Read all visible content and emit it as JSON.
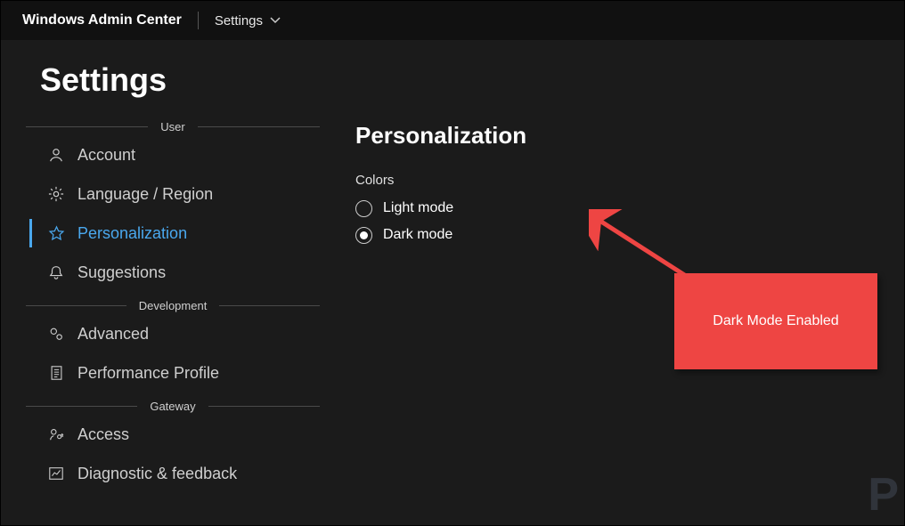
{
  "topbar": {
    "appTitle": "Windows Admin Center",
    "breadcrumb": "Settings"
  },
  "pageTitle": "Settings",
  "sidebar": {
    "sections": [
      {
        "label": "User",
        "items": [
          {
            "label": "Account"
          },
          {
            "label": "Language / Region"
          },
          {
            "label": "Personalization"
          },
          {
            "label": "Suggestions"
          }
        ]
      },
      {
        "label": "Development",
        "items": [
          {
            "label": "Advanced"
          },
          {
            "label": "Performance Profile"
          }
        ]
      },
      {
        "label": "Gateway",
        "items": [
          {
            "label": "Access"
          },
          {
            "label": "Diagnostic & feedback"
          }
        ]
      }
    ]
  },
  "main": {
    "title": "Personalization",
    "colors": {
      "groupLabel": "Colors",
      "options": [
        {
          "label": "Light mode",
          "selected": false
        },
        {
          "label": "Dark mode",
          "selected": true
        }
      ]
    }
  },
  "callout": {
    "text": "Dark Mode Enabled",
    "color": "#ee4543"
  }
}
